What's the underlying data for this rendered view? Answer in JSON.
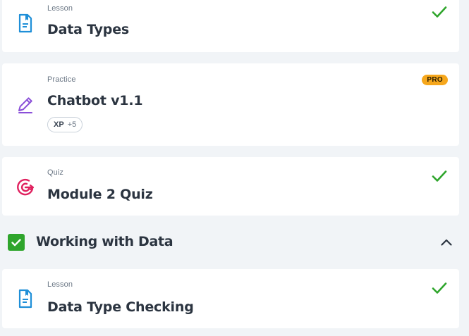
{
  "items": [
    {
      "type": "Lesson",
      "title": "Data Types",
      "icon": "lesson-doc-icon",
      "completed": true
    },
    {
      "type": "Practice",
      "title": "Chatbot v1.1",
      "icon": "pencil-icon",
      "badge": "PRO",
      "xp_label": "XP",
      "xp_value": "+5",
      "completed": false
    },
    {
      "type": "Quiz",
      "title": "Module 2 Quiz",
      "icon": "target-icon",
      "completed": true
    }
  ],
  "section": {
    "title": "Working with Data",
    "completed": true,
    "expanded": true
  },
  "section_items": [
    {
      "type": "Lesson",
      "title": "Data Type Checking",
      "icon": "lesson-doc-icon",
      "completed": true
    }
  ],
  "colors": {
    "background": "#f1f4f7",
    "card": "#ffffff",
    "check_green": "#2fa52c",
    "lesson_blue": "#1f8fd8",
    "practice_purple": "#8a4fd8",
    "quiz_pink": "#e0215f",
    "pro_badge": "#f6a71c"
  }
}
